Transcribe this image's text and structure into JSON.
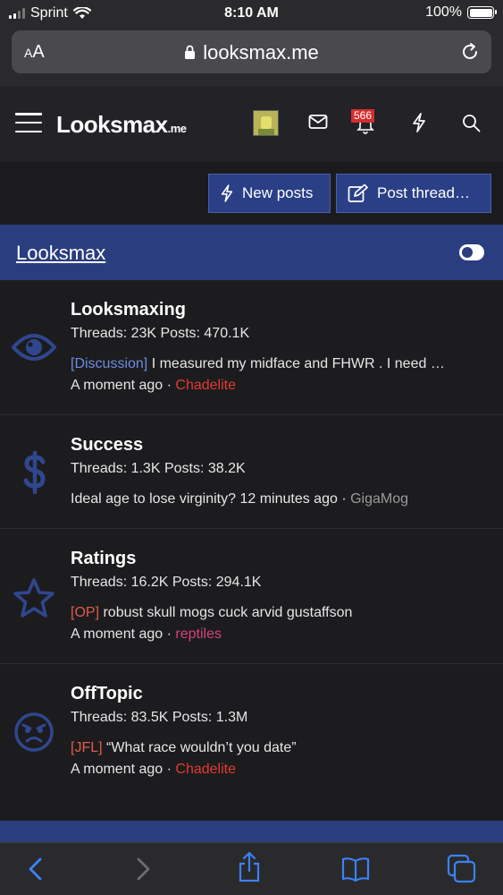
{
  "status_bar": {
    "carrier": "Sprint",
    "time": "8:10 AM",
    "battery": "100%",
    "battery_level": 1.0
  },
  "browser": {
    "text_size_label": "AA",
    "url": "looksmax.me"
  },
  "header": {
    "logo_main": "Looksmax",
    "logo_tld": ".me",
    "notification_count": "566"
  },
  "actions": {
    "new_posts": "New posts",
    "post_thread": "Post thread…"
  },
  "category": {
    "title": "Looksmax"
  },
  "forums": [
    {
      "title": "Looksmaxing",
      "stats": "Threads: 23K Posts: 470.1K",
      "prefix": "[Discussion]",
      "latest_title": "I measured my midface and FHWR . I need …",
      "time": "A moment ago",
      "separator": "·",
      "user": "Chadelite",
      "icon": "eye-icon"
    },
    {
      "title": "Success",
      "stats": "Threads: 1.3K Posts: 38.2K",
      "latest_title": "Ideal age to lose virginity?",
      "time": "12 minutes ago",
      "separator": "·",
      "user": "GigaMog",
      "icon": "dollar-icon"
    },
    {
      "title": "Ratings",
      "stats": "Threads: 16.2K Posts: 294.1K",
      "prefix": "[OP]",
      "latest_title": "robust skull mogs cuck arvid gustaffson",
      "time": "A moment ago",
      "separator": "·",
      "user": "reptiles",
      "icon": "star-icon"
    },
    {
      "title": "OffTopic",
      "stats": "Threads: 83.5K Posts: 1.3M",
      "prefix": "[JFL]",
      "latest_title": "“What race wouldn’t you date”",
      "time": "A moment ago",
      "separator": "·",
      "user": "Chadelite",
      "icon": "angry-face-icon"
    }
  ],
  "colors": {
    "accent_blue": "#2a3d7e",
    "icon_blue": "#30468f",
    "user_red": "#e23b30",
    "user_pink": "#d6417a",
    "safari_blue": "#3b82f6"
  }
}
